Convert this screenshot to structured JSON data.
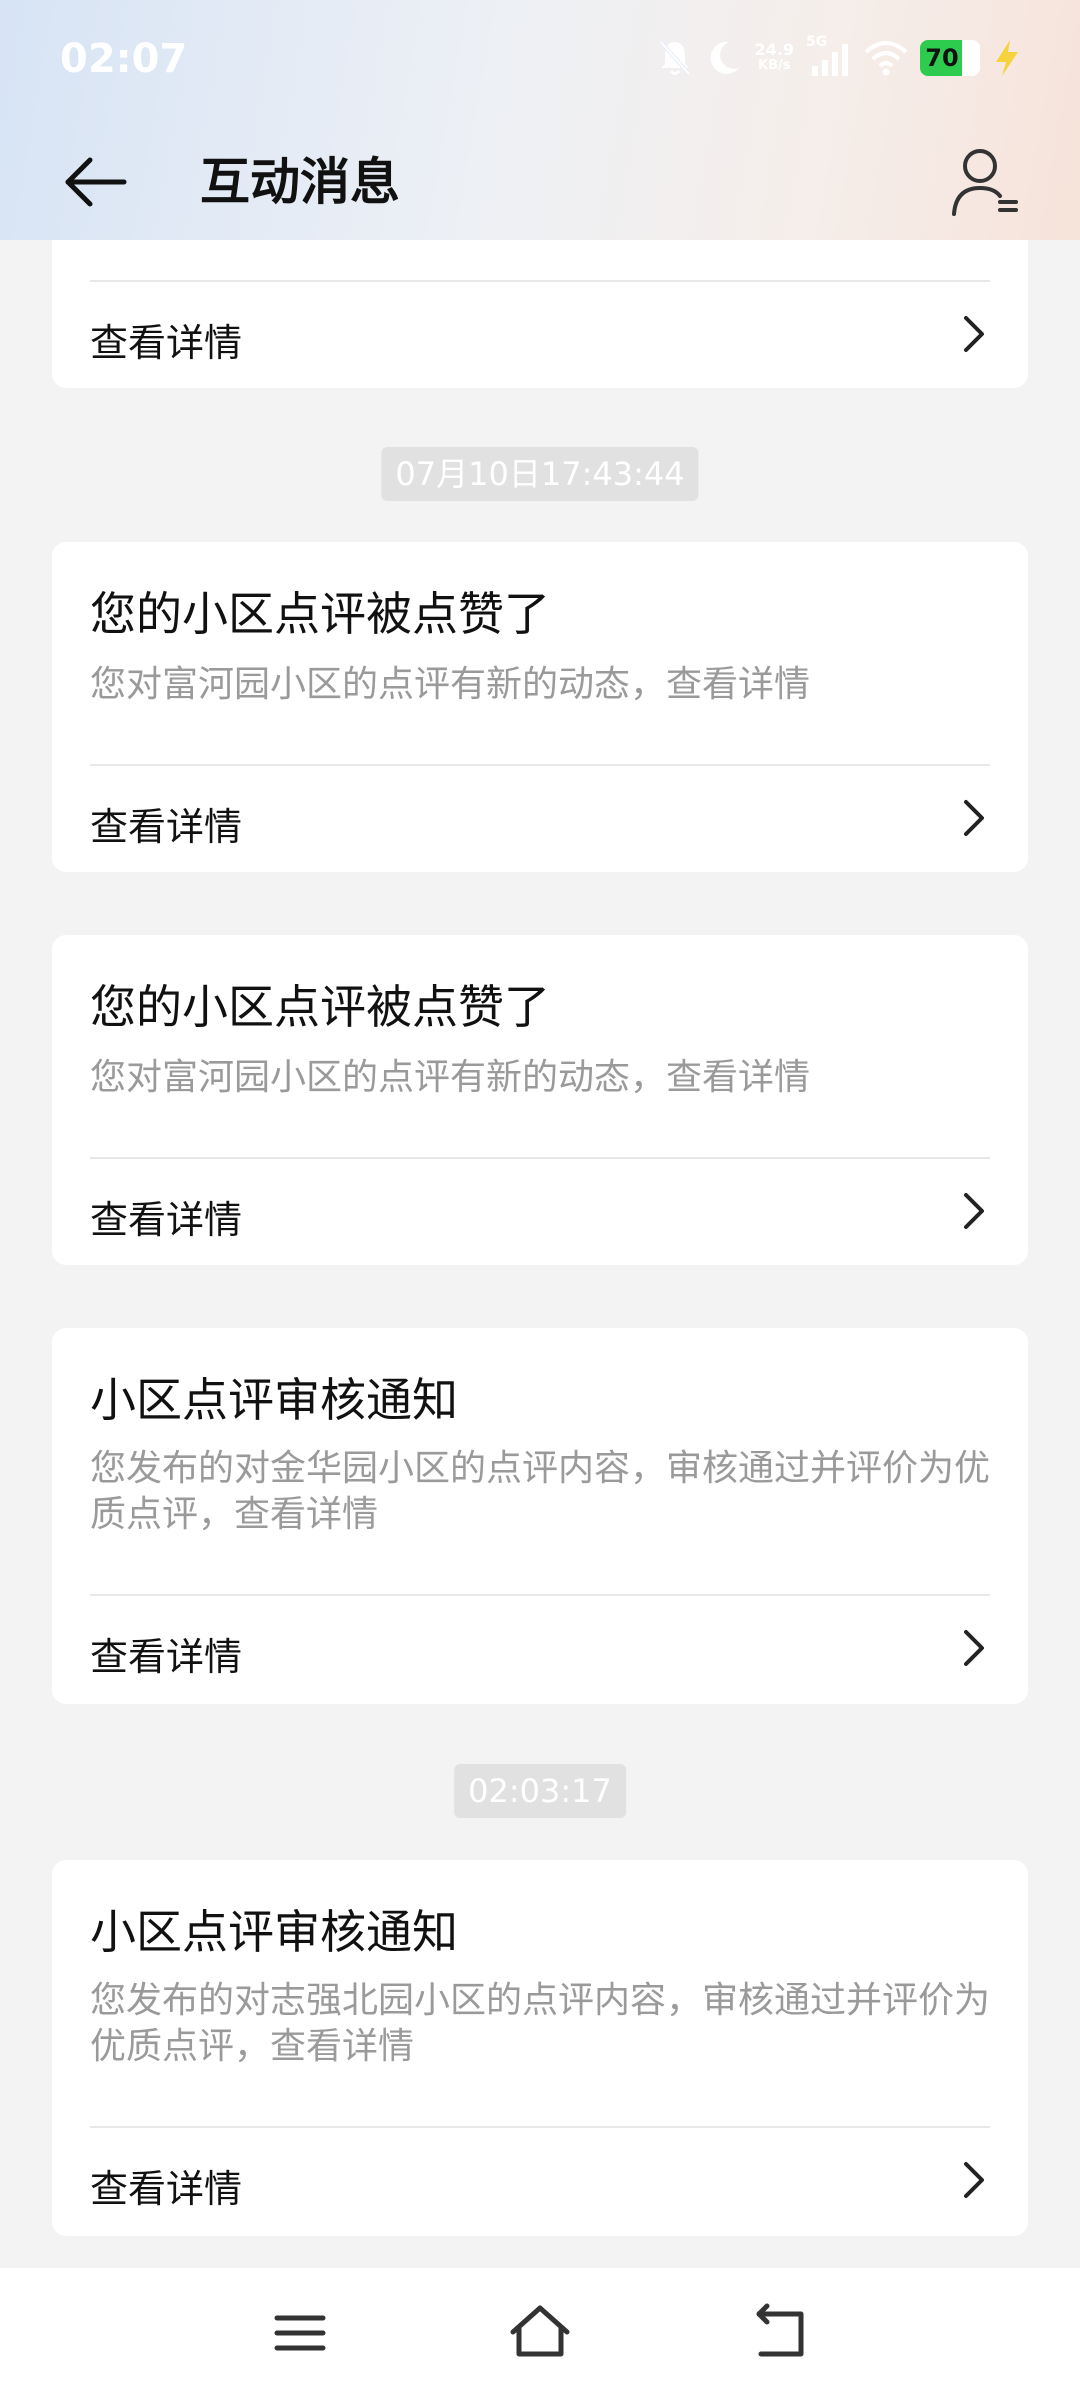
{
  "status_bar": {
    "time": "02:07",
    "net_speed_value": "24.9",
    "net_speed_unit": "KB/s",
    "network_type": "5G",
    "battery_level": "70",
    "battery_color": "#2ecc4e"
  },
  "header": {
    "title": "互动消息"
  },
  "messages": [
    {
      "detail_label": "查看详情"
    },
    {
      "time": "07月10日17:43:44"
    },
    {
      "title": "您的小区点评被点赞了",
      "desc": "您对富河园小区的点评有新的动态，查看详情",
      "detail_label": "查看详情"
    },
    {
      "title": "您的小区点评被点赞了",
      "desc": "您对富河园小区的点评有新的动态，查看详情",
      "detail_label": "查看详情"
    },
    {
      "title": "小区点评审核通知",
      "desc": "您发布的对金华园小区的点评内容，审核通过并评价为优质点评，查看详情",
      "detail_label": "查看详情"
    },
    {
      "time": "02:03:17"
    },
    {
      "title": "小区点评审核通知",
      "desc": "您发布的对志强北园小区的点评内容，审核通过并评价为优质点评，查看详情",
      "detail_label": "查看详情"
    }
  ],
  "nav_bar": {
    "icons": [
      "menu-icon",
      "home-icon",
      "back-gesture-icon"
    ]
  }
}
